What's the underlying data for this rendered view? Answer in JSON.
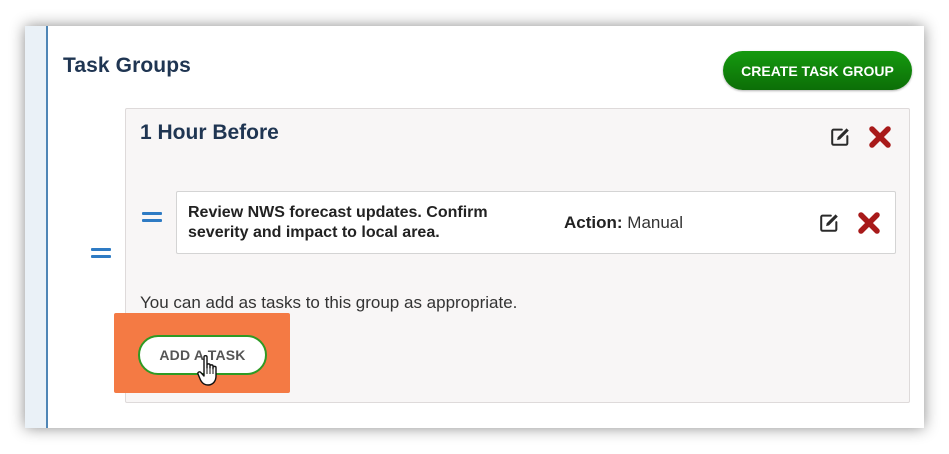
{
  "panel": {
    "title": "Task Groups",
    "create_button_label": "CREATE TASK GROUP"
  },
  "group": {
    "title": "1 Hour Before",
    "help_text": "You can add as tasks to this group as appropriate.",
    "add_task_label": "ADD A TASK"
  },
  "task": {
    "description": "Review NWS forecast updates. Confirm severity and impact to local area.",
    "action_label": "Action:",
    "action_value": "Manual"
  },
  "colors": {
    "primary_green": "#0f7f09",
    "title_navy": "#1f3552",
    "delete_red": "#b01d1d",
    "handle_blue": "#2e7bc4",
    "highlight_orange": "#f47a44"
  },
  "icons": [
    "drag-handle-icon",
    "edit-icon",
    "delete-icon",
    "hand-pointer-icon"
  ]
}
